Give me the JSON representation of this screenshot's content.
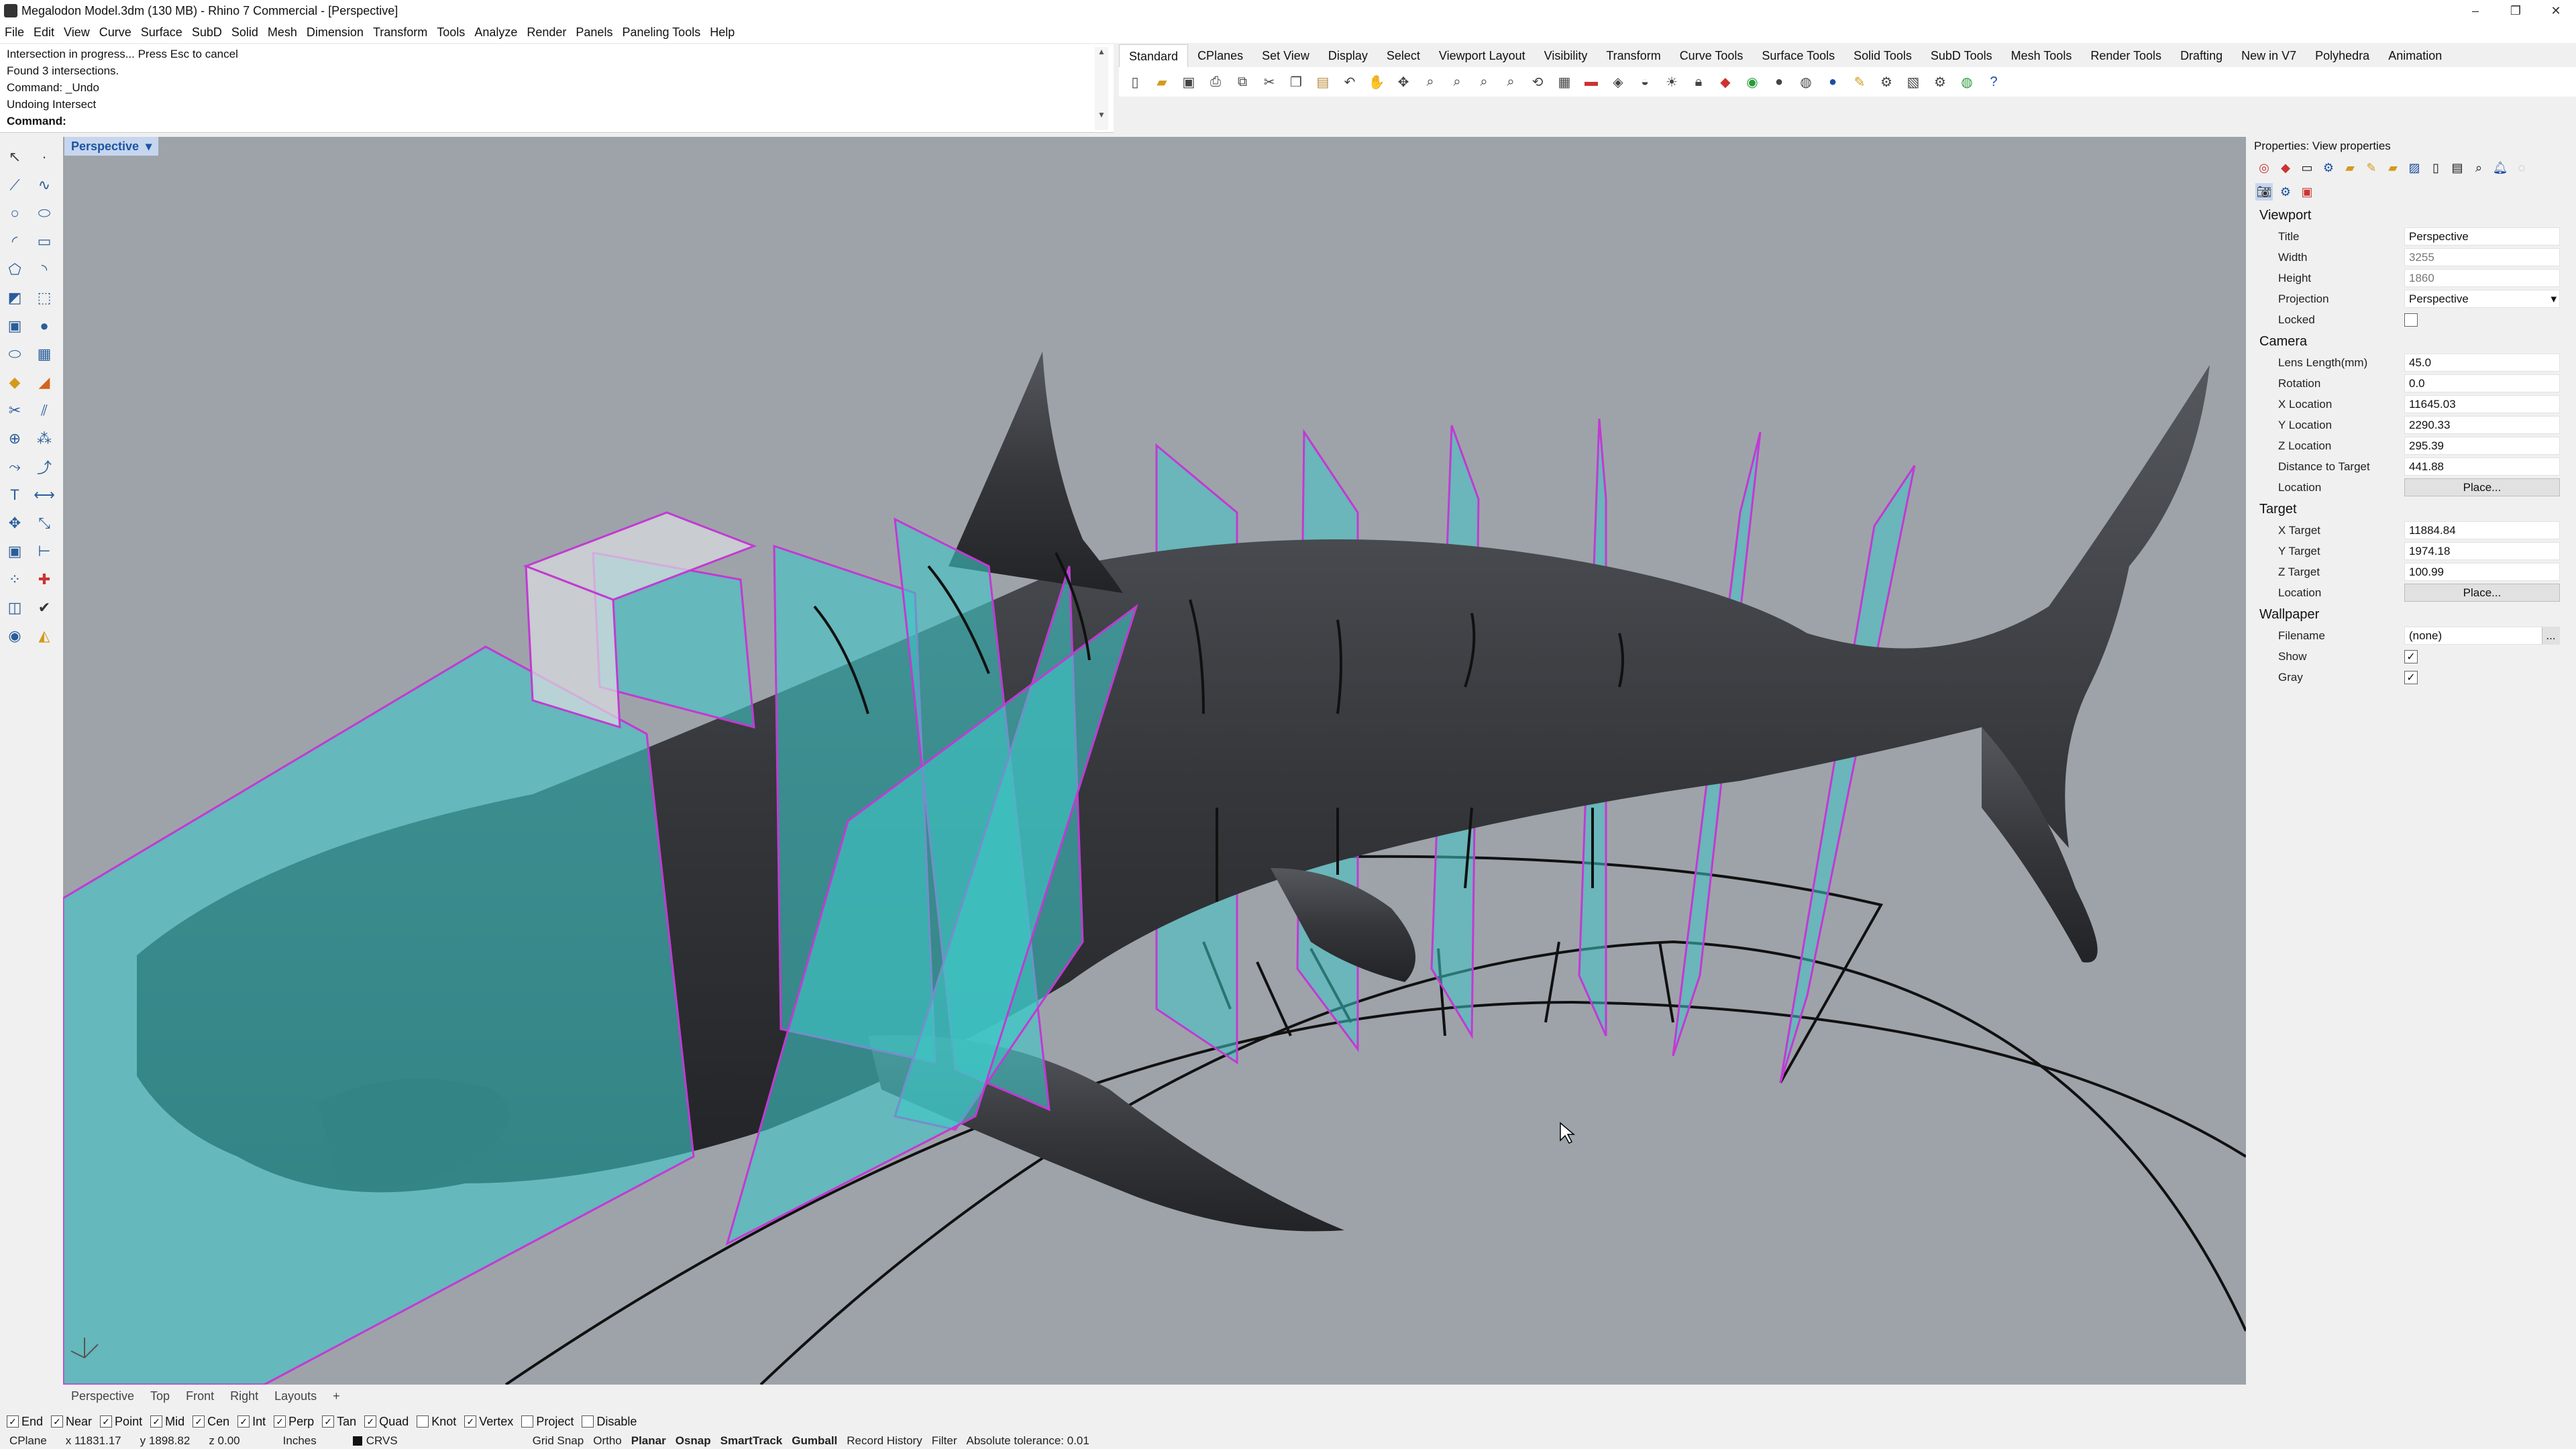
{
  "window": {
    "title": "Megalodon Model.3dm (130 MB) - Rhino 7 Commercial - [Perspective]",
    "controls": [
      "–",
      "❐",
      "✕"
    ]
  },
  "menu": [
    "File",
    "Edit",
    "View",
    "Curve",
    "Surface",
    "SubD",
    "Solid",
    "Mesh",
    "Dimension",
    "Transform",
    "Tools",
    "Analyze",
    "Render",
    "Panels",
    "Paneling Tools",
    "Help"
  ],
  "command_history": [
    "Intersection in progress... Press Esc to cancel",
    "Found 3 intersections.",
    "Command: _Undo",
    "Undoing Intersect"
  ],
  "command_prompt": "Command:",
  "toolbar_tabs": [
    "Standard",
    "CPlanes",
    "Set View",
    "Display",
    "Select",
    "Viewport Layout",
    "Visibility",
    "Transform",
    "Curve Tools",
    "Surface Tools",
    "Solid Tools",
    "SubD Tools",
    "Mesh Tools",
    "Render Tools",
    "Drafting",
    "New in V7",
    "Polyhedra",
    "Animation"
  ],
  "toolbar_icons": [
    "new-icon",
    "open-icon",
    "save-icon",
    "print-icon",
    "import-icon",
    "cut-icon",
    "copy-icon",
    "paste-icon",
    "undo-icon",
    "pan-icon",
    "move-view-icon",
    "zoom-icon",
    "zoom-window-icon",
    "zoom-extents-icon",
    "zoom-selected-icon",
    "rotate-view-icon",
    "grid-icon",
    "layer-icon",
    "cplane-icon",
    "named-view-icon",
    "light-icon",
    "lock-icon",
    "properties-icon",
    "color-wheel-icon",
    "material-icon",
    "render-icon",
    "shaded-sphere-icon",
    "environment-icon",
    "analysis-icon",
    "plugin-icon",
    "options-icon",
    "earth-icon",
    "help-icon"
  ],
  "viewport": {
    "name": "Perspective",
    "axis_labels": [
      "x",
      "y",
      "z"
    ]
  },
  "viewport_tabs": [
    "Perspective",
    "Top",
    "Front",
    "Right",
    "Layouts",
    "+"
  ],
  "properties": {
    "title": "Properties: View properties",
    "sections": {
      "viewport": "Viewport",
      "camera": "Camera",
      "target": "Target",
      "wallpaper": "Wallpaper"
    },
    "viewport_rows": [
      {
        "label": "Title",
        "value": "Perspective"
      },
      {
        "label": "Width",
        "value": "3255"
      },
      {
        "label": "Height",
        "value": "1860"
      },
      {
        "label": "Projection",
        "value": "Perspective"
      }
    ],
    "locked_label": "Locked",
    "camera_rows": [
      {
        "label": "Lens Length(mm)",
        "value": "45.0"
      },
      {
        "label": "Rotation",
        "value": "0.0"
      },
      {
        "label": "X Location",
        "value": "11645.03"
      },
      {
        "label": "Y Location",
        "value": "2290.33"
      },
      {
        "label": "Z Location",
        "value": "295.39"
      },
      {
        "label": "Distance to Target",
        "value": "441.88"
      }
    ],
    "camera_location_label": "Location",
    "place_label": "Place...",
    "target_rows": [
      {
        "label": "X Target",
        "value": "11884.84"
      },
      {
        "label": "Y Target",
        "value": "1974.18"
      },
      {
        "label": "Z Target",
        "value": "100.99"
      }
    ],
    "target_location_label": "Location",
    "wallpaper_filename_label": "Filename",
    "wallpaper_filename_value": "(none)",
    "wallpaper_browse": "...",
    "show_label": "Show",
    "gray_label": "Gray"
  },
  "osnaps": [
    {
      "label": "End",
      "checked": true
    },
    {
      "label": "Near",
      "checked": true
    },
    {
      "label": "Point",
      "checked": true
    },
    {
      "label": "Mid",
      "checked": true
    },
    {
      "label": "Cen",
      "checked": true
    },
    {
      "label": "Int",
      "checked": true
    },
    {
      "label": "Perp",
      "checked": true
    },
    {
      "label": "Tan",
      "checked": true
    },
    {
      "label": "Quad",
      "checked": true
    },
    {
      "label": "Knot",
      "checked": false
    },
    {
      "label": "Vertex",
      "checked": true
    },
    {
      "label": "Project",
      "checked": false
    },
    {
      "label": "Disable",
      "checked": false
    }
  ],
  "status": {
    "cplane": "CPlane",
    "x": "x 11831.17",
    "y": "y 1898.82",
    "z": "z 0.00",
    "units": "Inches",
    "layer": "CRVS",
    "toggles": [
      {
        "label": "Grid Snap",
        "bold": false
      },
      {
        "label": "Ortho",
        "bold": false
      },
      {
        "label": "Planar",
        "bold": true
      },
      {
        "label": "Osnap",
        "bold": true
      },
      {
        "label": "SmartTrack",
        "bold": true
      },
      {
        "label": "Gumball",
        "bold": true
      },
      {
        "label": "Record History",
        "bold": false
      },
      {
        "label": "Filter",
        "bold": false
      },
      {
        "label": "Absolute tolerance: 0.01",
        "bold": false
      }
    ]
  },
  "colors": {
    "viewport_bg": "#9ea3aa",
    "shark": "#3a3c40",
    "plane": "#3fc6c6",
    "plane_edge": "#c23ad3",
    "tab_active": "#c6d6ee"
  }
}
